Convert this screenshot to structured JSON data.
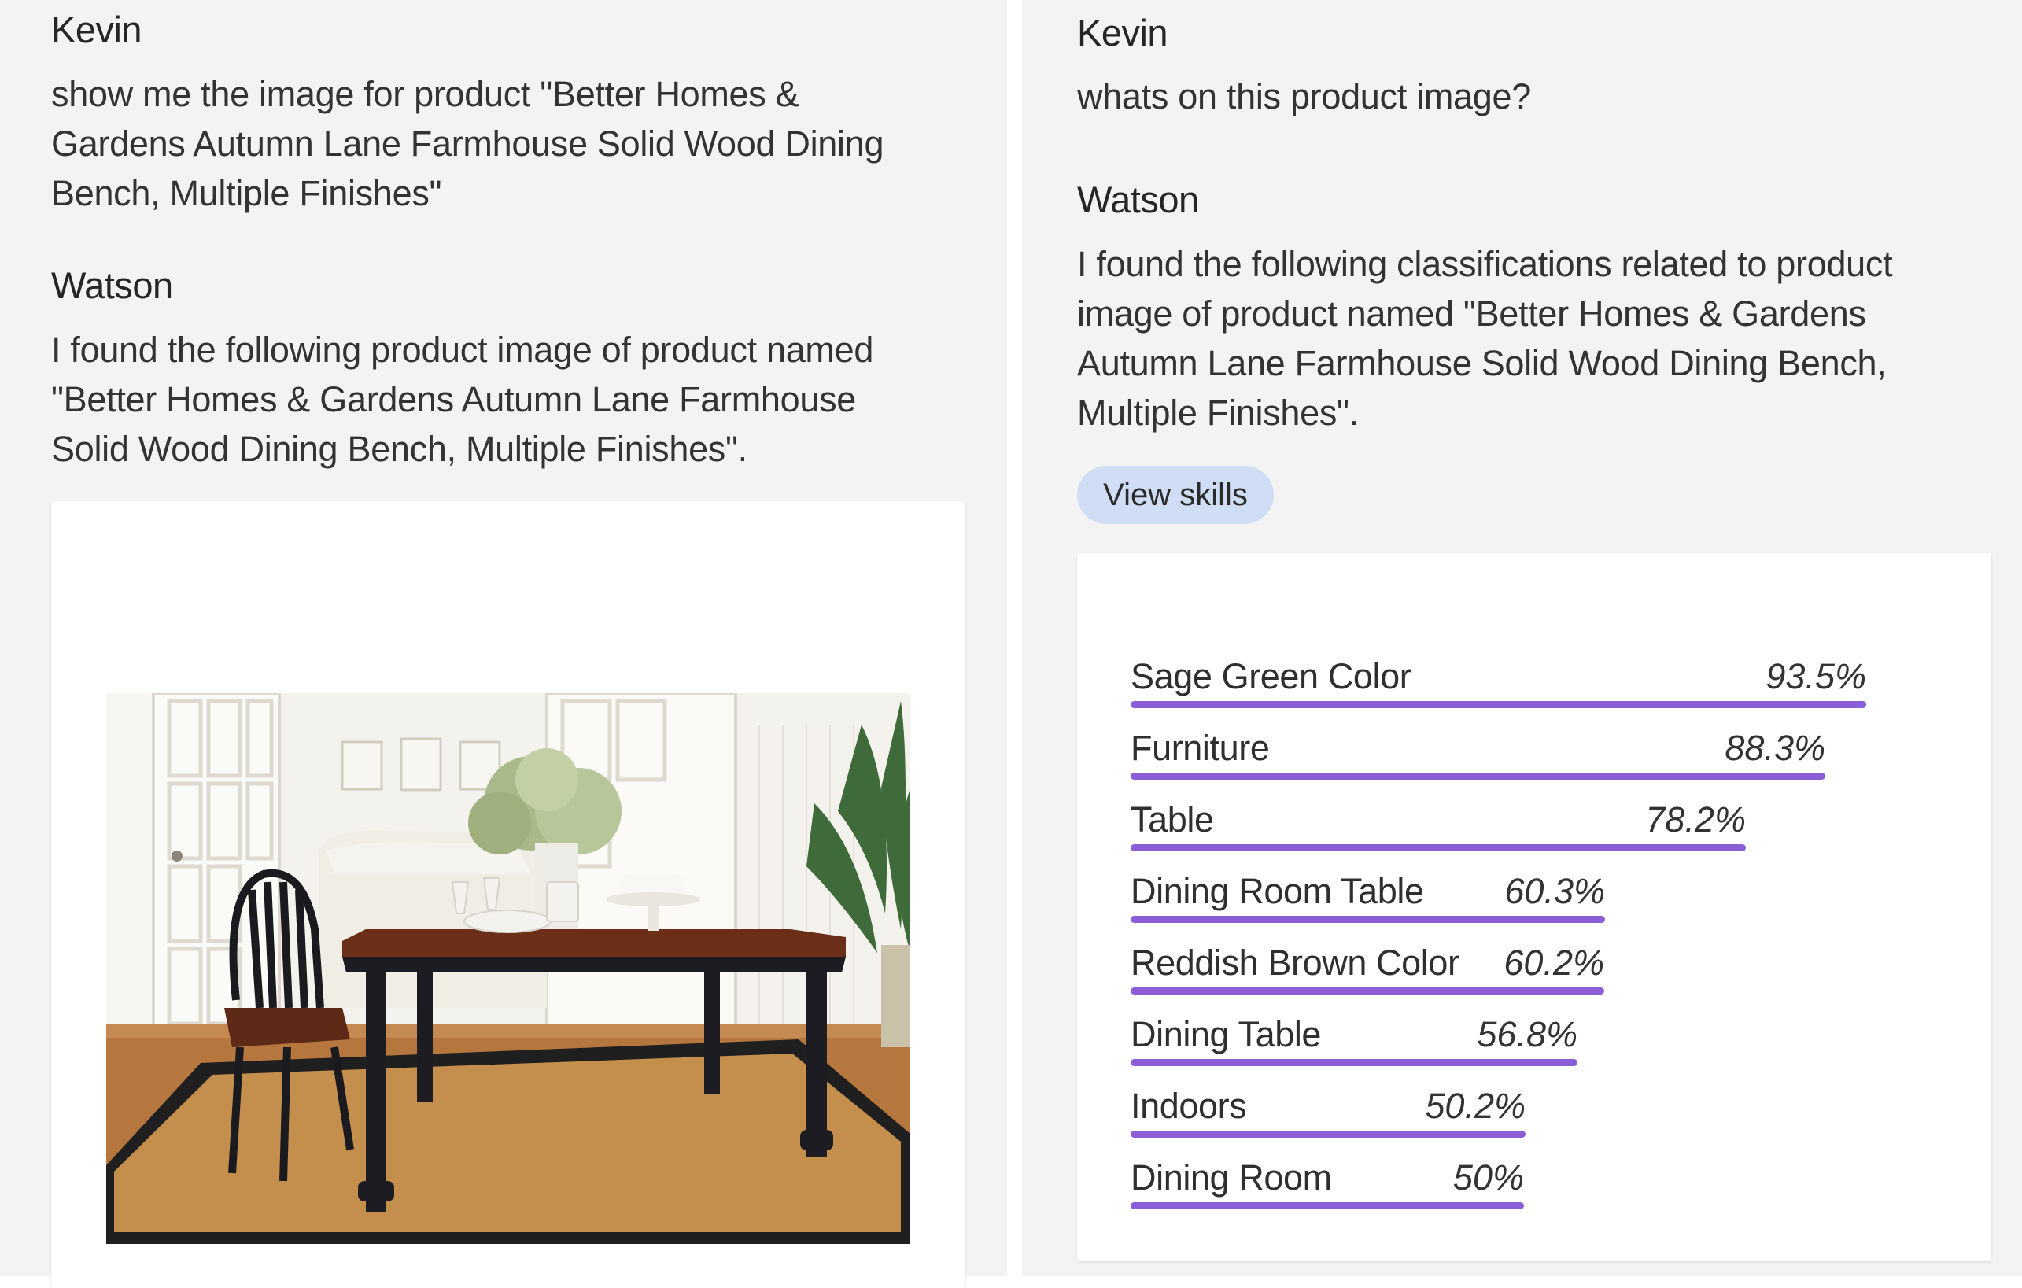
{
  "left": {
    "user_name": "Kevin",
    "user_message": "show me the image for product \"Better Homes & Gardens Autumn Lane Farmhouse Solid Wood Dining Bench, Multiple Finishes\"",
    "user_lines": [
      "show me the image for product \"Better Homes &",
      "Gardens Autumn Lane Farmhouse Solid Wood Dining",
      "Bench, Multiple Finishes\""
    ],
    "bot_name": "Watson",
    "bot_lines": [
      "I found the following product image of product named",
      "\"Better Homes & Gardens Autumn Lane Farmhouse",
      "Solid Wood Dining Bench, Multiple Finishes\"."
    ]
  },
  "right": {
    "user_name": "Kevin",
    "user_message": "whats on this product image?",
    "bot_name": "Watson",
    "bot_lines": [
      "I found the following classifications related to product",
      "image of product named \"Better Homes & Gardens",
      "Autumn Lane Farmhouse Solid Wood Dining Bench,",
      "Multiple Finishes\"."
    ],
    "view_skills_label": "View skills",
    "bar_color": "#8a5ed6"
  },
  "chart_data": {
    "type": "bar",
    "orientation": "horizontal",
    "categories": [
      "Sage Green Color",
      "Furniture",
      "Table",
      "Dining Room Table",
      "Reddish Brown Color",
      "Dining Table",
      "Indoors",
      "Dining Room"
    ],
    "values": [
      93.5,
      88.3,
      78.2,
      60.3,
      60.2,
      56.8,
      50.2,
      50
    ],
    "value_labels": [
      "93.5%",
      "88.3%",
      "78.2%",
      "60.3%",
      "60.2%",
      "56.8%",
      "50.2%",
      "50%"
    ],
    "unit": "%",
    "xlim": [
      0,
      100
    ]
  }
}
